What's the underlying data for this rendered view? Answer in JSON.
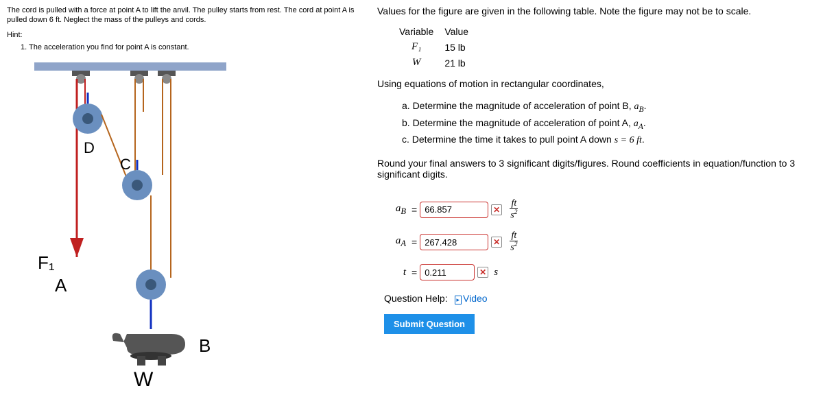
{
  "problem_text": "The cord is pulled with a force at point A to lift the anvil. The pulley starts from rest. The cord at point A is pulled down 6 ft. Neglect the mass of the pulleys and cords.",
  "hint_label": "Hint:",
  "hint_item": "1. The acceleration you find for point A is constant.",
  "right": {
    "intro": "Values for the figure are given in the following table. Note the figure may not be to scale.",
    "table": {
      "h_variable": "Variable",
      "h_value": "Value",
      "rows": [
        {
          "var": "F₁",
          "val": "15 lb"
        },
        {
          "var": "W",
          "val": "21 lb"
        }
      ]
    },
    "using": "Using equations of motion in rectangular coordinates,",
    "parts": {
      "a": "a. Determine the magnitude of acceleration of point B, ",
      "a_sym": "a",
      "a_sub": "B",
      "b": "b. Determine the magnitude of acceleration of point A, ",
      "b_sym": "a",
      "b_sub": "A",
      "c_pre": "c. Determine the time it takes to pull point A down ",
      "c_eq": "s = 6 ft"
    },
    "round": "Round your final answers to 3 significant digits/figures. Round coefficients in equation/function to 3 significant digits.",
    "answers": {
      "aB_label": "aB",
      "aB_value": "66.857",
      "aA_label": "aA",
      "aA_value": "267.428",
      "t_label": "t",
      "t_value": "0.211",
      "unit_ft": "ft",
      "unit_s2": "s²",
      "unit_s": "s"
    },
    "qhelp": "Question Help:",
    "video": "Video",
    "submit": "Submit Question"
  },
  "figure": {
    "labels": {
      "D": "D",
      "C": "C",
      "F1": "F₁",
      "A": "A",
      "B": "B",
      "W": "W"
    }
  }
}
